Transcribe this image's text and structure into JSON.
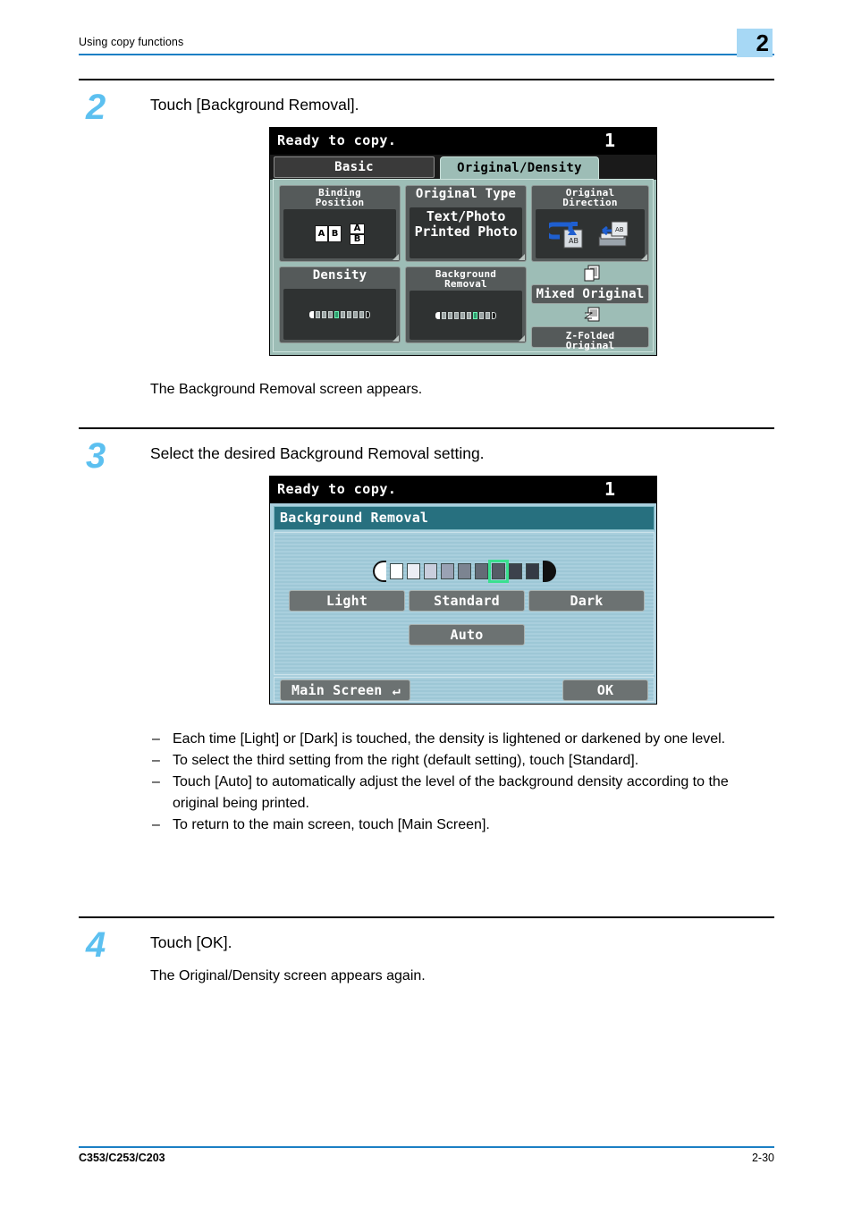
{
  "header": {
    "title": "Using copy functions",
    "chapter": "2"
  },
  "footer": {
    "model": "C353/C253/C203",
    "page": "2-30"
  },
  "steps": [
    {
      "number": "2",
      "instruction": "Touch [Background Removal].",
      "result": "The Background Removal screen appears."
    },
    {
      "number": "3",
      "instruction": "Select the desired Background Removal setting."
    },
    {
      "number": "4",
      "instruction": "Touch [OK].",
      "result": "The Original/Density screen appears again."
    }
  ],
  "bullets": [
    "Each time [Light] or [Dark] is touched, the density is lightened or darkened by one level.",
    "To select the third setting from the right (default setting), touch [Standard].",
    "Touch [Auto] to automatically adjust the level of the background density according to the original being printed.",
    "To return to the main screen, touch [Main Screen]."
  ],
  "screen1": {
    "status_message": "Ready to copy.",
    "copy_count": "1",
    "tabs": [
      {
        "label": "Basic",
        "active": false
      },
      {
        "label": "Original/Density",
        "active": true
      }
    ],
    "tiles": {
      "binding_position": {
        "title_line1": "Binding",
        "title_line2": "Position",
        "page_a": "A",
        "page_b": "B",
        "page_a2": "A",
        "page_b2": "B"
      },
      "original_type": {
        "title": "Original Type",
        "option1": "Text/Photo",
        "option2": "Printed Photo"
      },
      "original_direction": {
        "title_line1": "Original",
        "title_line2": "Direction",
        "icon1_label": "AB",
        "icon2_label": "AB"
      },
      "density": {
        "title": "Density",
        "levels": 9,
        "selected_index": 4
      },
      "background_removal": {
        "title_line1": "Background",
        "title_line2": "Removal",
        "levels": 9,
        "selected_index": 6
      }
    },
    "buttons": {
      "mixed_original": "Mixed Original",
      "z_folded_line1": "Z-Folded",
      "z_folded_line2": "Original"
    }
  },
  "screen2": {
    "status_message": "Ready to copy.",
    "copy_count": "1",
    "title": "Background Removal",
    "swatches": [
      {
        "kind": "cap-left",
        "color": "#ffffff"
      },
      {
        "kind": "square",
        "color": "#ffffff"
      },
      {
        "kind": "square",
        "color": "#eceef5"
      },
      {
        "kind": "square",
        "color": "#c9cedd"
      },
      {
        "kind": "square",
        "color": "#9aa2b4"
      },
      {
        "kind": "square",
        "color": "#7c8491"
      },
      {
        "kind": "square",
        "color": "#646b76"
      },
      {
        "kind": "square",
        "color": "#555c66",
        "selected": true
      },
      {
        "kind": "square",
        "color": "#3c424c"
      },
      {
        "kind": "square",
        "color": "#343a44"
      },
      {
        "kind": "cap-right",
        "color": "#111111"
      }
    ],
    "selected_swatch_index": 7,
    "buttons": {
      "light": "Light",
      "standard": "Standard",
      "dark": "Dark",
      "auto": "Auto",
      "main_screen": "Main Screen",
      "ok": "OK"
    }
  },
  "colors": {
    "accent_blue": "#1b7fc4",
    "step_number": "#5cc0f0",
    "badge_bg": "#a7d8f5",
    "lcd_bg": "#9dbdb6",
    "lcd_panel_blue": "#a9cfdd",
    "select_green": "#3ae08f"
  }
}
